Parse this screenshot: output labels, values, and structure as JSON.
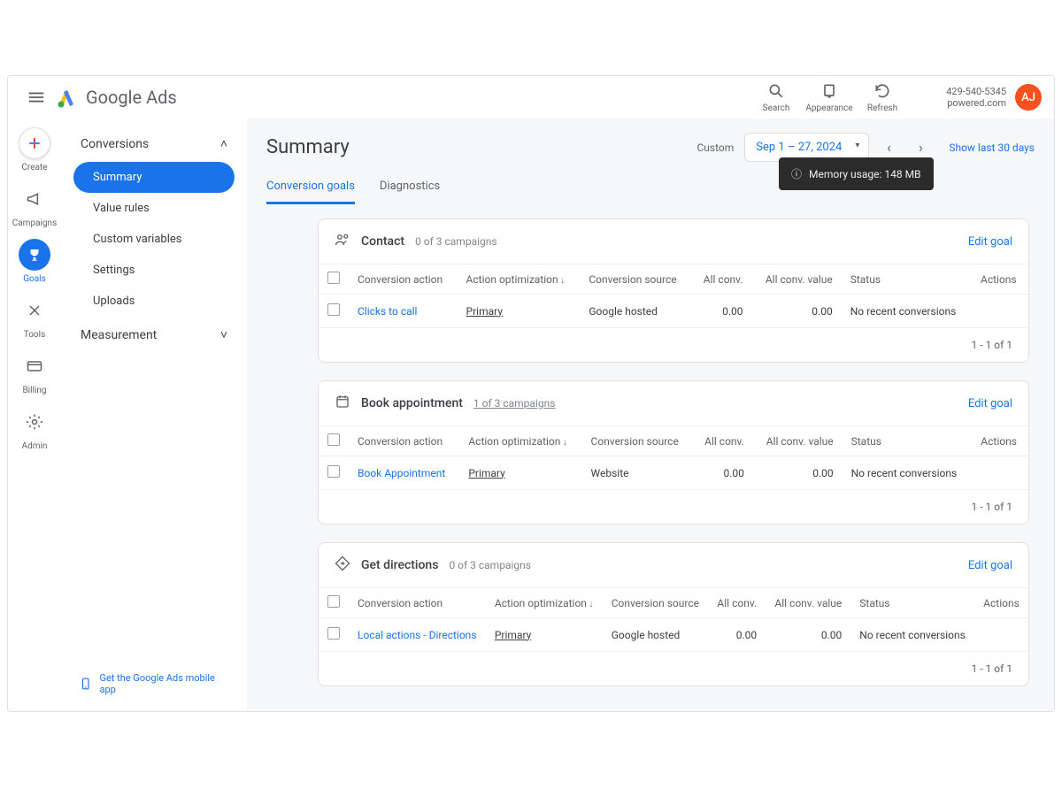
{
  "header": {
    "brand": "Google Ads",
    "buttons": {
      "search": "Search",
      "appearance": "Appearance",
      "refresh": "Refresh"
    },
    "overlay": "Memory usage: 148 MB",
    "account_id": "429-540-5345",
    "account_domain": "powered.com",
    "avatar": "AJ"
  },
  "rail": {
    "create": "Create",
    "campaigns": "Campaigns",
    "goals": "Goals",
    "tools": "Tools",
    "billing": "Billing",
    "admin": "Admin"
  },
  "subnav": {
    "section_conversions": "Conversions",
    "items": [
      "Summary",
      "Value rules",
      "Custom variables",
      "Settings",
      "Uploads"
    ],
    "section_measurement": "Measurement",
    "promo": "Get the Google Ads mobile app"
  },
  "main": {
    "title": "Summary",
    "date_label": "Custom",
    "date_value": "Sep 1 – 27, 2024",
    "show_last": "Show last 30 days",
    "tabs": [
      "Conversion goals",
      "Diagnostics"
    ]
  },
  "columns": {
    "action": "Conversion action",
    "optimization": "Action optimization",
    "source": "Conversion source",
    "all_conv": "All conv.",
    "all_conv_value": "All conv. value",
    "status": "Status",
    "actions": "Actions"
  },
  "cards": [
    {
      "icon": "contact",
      "title": "Contact",
      "sub": "0 of 3 campaigns",
      "sub_underline": false,
      "edit": "Edit goal",
      "rows": [
        {
          "action": "Clicks to call",
          "opt": "Primary",
          "source": "Google hosted",
          "conv": "0.00",
          "val": "0.00",
          "status": "No recent conversions"
        }
      ],
      "footer": "1 - 1 of 1"
    },
    {
      "icon": "calendar",
      "title": "Book appointment",
      "sub": "1 of 3 campaigns",
      "sub_underline": true,
      "edit": "Edit goal",
      "rows": [
        {
          "action": "Book Appointment",
          "opt": "Primary",
          "source": "Website",
          "conv": "0.00",
          "val": "0.00",
          "status": "No recent conversions"
        }
      ],
      "footer": "1 - 1 of 1"
    },
    {
      "icon": "directions",
      "title": "Get directions",
      "sub": "0 of 3 campaigns",
      "sub_underline": false,
      "edit": "Edit goal",
      "rows": [
        {
          "action": "Local actions - Directions",
          "opt": "Primary",
          "source": "Google hosted",
          "conv": "0.00",
          "val": "0.00",
          "status": "No recent conversions"
        }
      ],
      "footer": "1 - 1 of 1"
    }
  ]
}
